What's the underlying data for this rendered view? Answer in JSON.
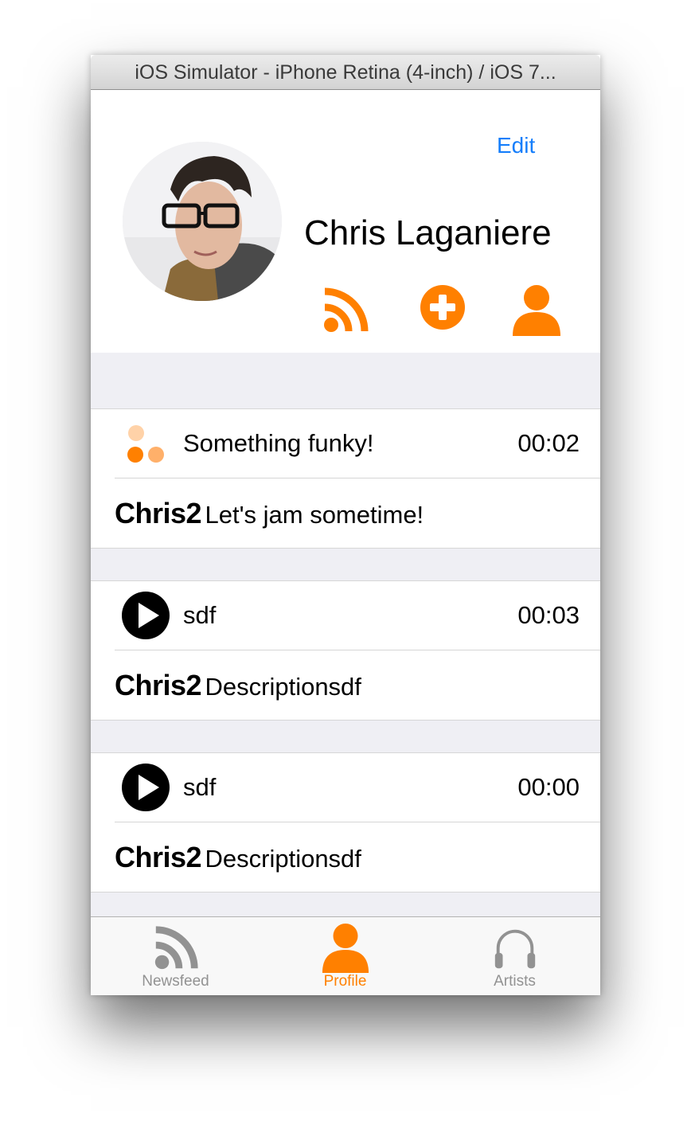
{
  "window": {
    "title": "iOS Simulator - iPhone Retina (4-inch) / iOS 7..."
  },
  "profile": {
    "edit_label": "Edit",
    "name": "Chris Laganiere",
    "actions": [
      "rss-icon",
      "plus-circle-icon",
      "person-icon"
    ]
  },
  "feed": [
    {
      "title": "Something funky!",
      "time": "00:02",
      "author": "Chris2",
      "description": "Let's jam sometime!",
      "state": "loading"
    },
    {
      "title": "sdf",
      "time": "00:03",
      "author": "Chris2",
      "description": "Descriptionsdf",
      "state": "play"
    },
    {
      "title": "sdf",
      "time": "00:00",
      "author": "Chris2",
      "description": "Descriptionsdf",
      "state": "play"
    }
  ],
  "tabs": [
    {
      "label": "Newsfeed",
      "icon": "rss-icon",
      "active": false
    },
    {
      "label": "Profile",
      "icon": "person-icon",
      "active": true
    },
    {
      "label": "Artists",
      "icon": "headphones-icon",
      "active": false
    }
  ],
  "colors": {
    "accent": "#ff8000",
    "link": "#157efb",
    "inactive": "#929292",
    "separator_bg": "#efeff4"
  }
}
